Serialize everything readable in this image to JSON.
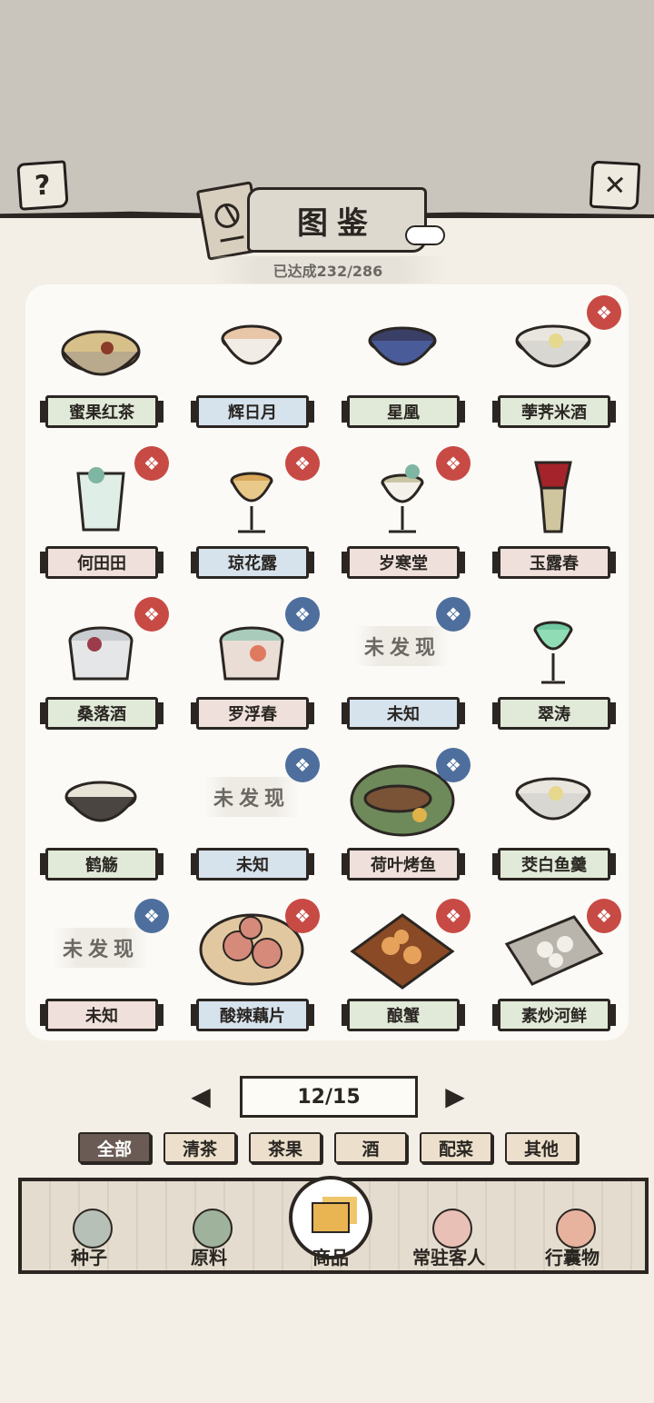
{
  "header": {
    "help_icon": "?",
    "close_icon": "✕",
    "title": "图鉴",
    "progress": "已达成232/286"
  },
  "items": [
    {
      "name": "蜜果红茶",
      "label_color": "g",
      "badge": null,
      "discovered": true,
      "food": "bowl-tea"
    },
    {
      "name": "辉日月",
      "label_color": "b",
      "badge": null,
      "discovered": true,
      "food": "cup"
    },
    {
      "name": "星凰",
      "label_color": "g",
      "badge": null,
      "discovered": true,
      "food": "blue-bowl"
    },
    {
      "name": "荸荠米酒",
      "label_color": "g",
      "badge": "red",
      "discovered": true,
      "food": "white-bowl"
    },
    {
      "name": "何田田",
      "label_color": "p",
      "badge": "red",
      "discovered": true,
      "food": "glass"
    },
    {
      "name": "琼花露",
      "label_color": "b",
      "badge": "red",
      "discovered": true,
      "food": "goblet"
    },
    {
      "name": "岁寒堂",
      "label_color": "p",
      "badge": "red",
      "discovered": true,
      "food": "goblet-white"
    },
    {
      "name": "玉露春",
      "label_color": "p",
      "badge": null,
      "discovered": true,
      "food": "vessel"
    },
    {
      "name": "桑落酒",
      "label_color": "g",
      "badge": "red",
      "discovered": true,
      "food": "pot"
    },
    {
      "name": "罗浮春",
      "label_color": "p",
      "badge": "blue",
      "discovered": true,
      "food": "pot-green"
    },
    {
      "name": "未知",
      "label_color": "b",
      "badge": "blue",
      "discovered": false,
      "undiscovered_text": "未发现"
    },
    {
      "name": "翠涛",
      "label_color": "g",
      "badge": null,
      "discovered": true,
      "food": "green-goblet"
    },
    {
      "name": "鹤觞",
      "label_color": "g",
      "badge": null,
      "discovered": true,
      "food": "dark-bowl"
    },
    {
      "name": "未知",
      "label_color": "b",
      "badge": "blue",
      "discovered": false,
      "undiscovered_text": "未发现"
    },
    {
      "name": "荷叶烤鱼",
      "label_color": "p",
      "badge": "blue",
      "discovered": true,
      "food": "fish"
    },
    {
      "name": "茭白鱼羹",
      "label_color": "g",
      "badge": null,
      "discovered": true,
      "food": "white-bowl"
    },
    {
      "name": "未知",
      "label_color": "p",
      "badge": "blue",
      "discovered": false,
      "undiscovered_text": "未发现"
    },
    {
      "name": "酸辣藕片",
      "label_color": "b",
      "badge": "red",
      "discovered": true,
      "food": "lotus"
    },
    {
      "name": "酿蟹",
      "label_color": "g",
      "badge": "red",
      "discovered": true,
      "food": "crab"
    },
    {
      "name": "素炒河鲜",
      "label_color": "g",
      "badge": "red",
      "discovered": true,
      "food": "plate"
    }
  ],
  "pager": {
    "prev_icon": "◀",
    "next_icon": "▶",
    "text": "12/15"
  },
  "filters": [
    "全部",
    "清茶",
    "茶果",
    "酒",
    "配菜",
    "其他"
  ],
  "nav": [
    "种子",
    "原料",
    "商品",
    "常驻客人",
    "行囊物"
  ],
  "colors": {
    "red_badge": "#c84a45",
    "blue_badge": "#4e6f9d",
    "active_filter": "#6a5c55"
  }
}
